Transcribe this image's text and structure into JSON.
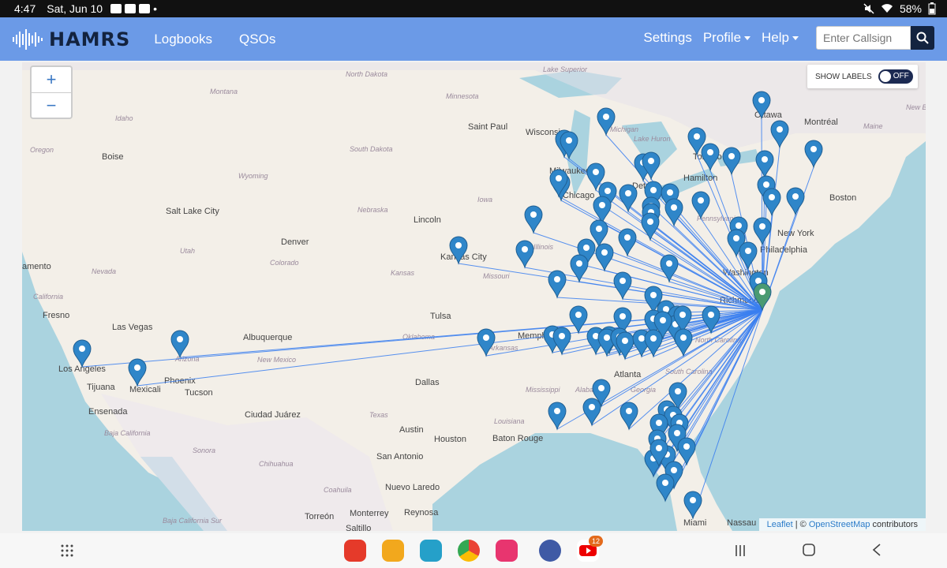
{
  "status_bar": {
    "time": "4:47",
    "date": "Sat, Jun 10",
    "battery": "58%"
  },
  "navbar": {
    "brand": "HAMRS",
    "links": {
      "logbooks": "Logbooks",
      "qsos": "QSOs"
    },
    "settings": "Settings",
    "profile": "Profile",
    "help": "Help",
    "search_placeholder": "Enter Callsign"
  },
  "map": {
    "zoom_in": "+",
    "zoom_out": "−",
    "show_labels": "SHOW LABELS",
    "toggle_state": "OFF",
    "attribution_leaflet": "Leaflet",
    "attribution_sep": " | © ",
    "attribution_osm": "OpenStreetMap",
    "attribution_rest": " contributors",
    "cities": [
      "North Dakota",
      "Montana",
      "Minnesota",
      "Idaho",
      "Oregon",
      "Boise",
      "South Dakota",
      "Saint Paul",
      "Wisconsin",
      "Michigan",
      "Milwaukee",
      "Chicago",
      "Lake Huron",
      "Detroit",
      "Toronto",
      "Hamilton",
      "Ottawa",
      "Montréal",
      "Maine",
      "Wyoming",
      "Iowa",
      "Nebraska",
      "Lincoln",
      "Salt Lake City",
      "Utah",
      "Denver",
      "Colorado",
      "Kansas City",
      "Kansas",
      "Missouri",
      "Illinois",
      "New York",
      "Boston",
      "Philadelphia",
      "Washington",
      "Richmond",
      "Pennsylvania",
      "Nevada",
      "California",
      "Fresno",
      "Las Vegas",
      "Los Angeles",
      "Arizona",
      "Albuquerque",
      "Phoenix",
      "Tucson",
      "New Mexico",
      "Oklahoma",
      "Tulsa",
      "Memphis",
      "Arkansas",
      "Tijuana",
      "Mexicali",
      "Ensenada",
      "Dallas",
      "Ciudad Juárez",
      "Texas",
      "Austin",
      "Houston",
      "Baton Rouge",
      "Louisiana",
      "Mississippi",
      "Alabama",
      "Atlanta",
      "Georgia",
      "South Carolina",
      "North Carolina",
      "San Antonio",
      "Nuevo Laredo",
      "Reynosa",
      "Monterrey",
      "Torreón",
      "Saltillo",
      "Sonora",
      "Chihuahua",
      "Coahuila",
      "Baja California",
      "Miami",
      "Nassau",
      "Lake Superior",
      "New Brunswick",
      "amento",
      "Baja California Sur"
    ]
  }
}
